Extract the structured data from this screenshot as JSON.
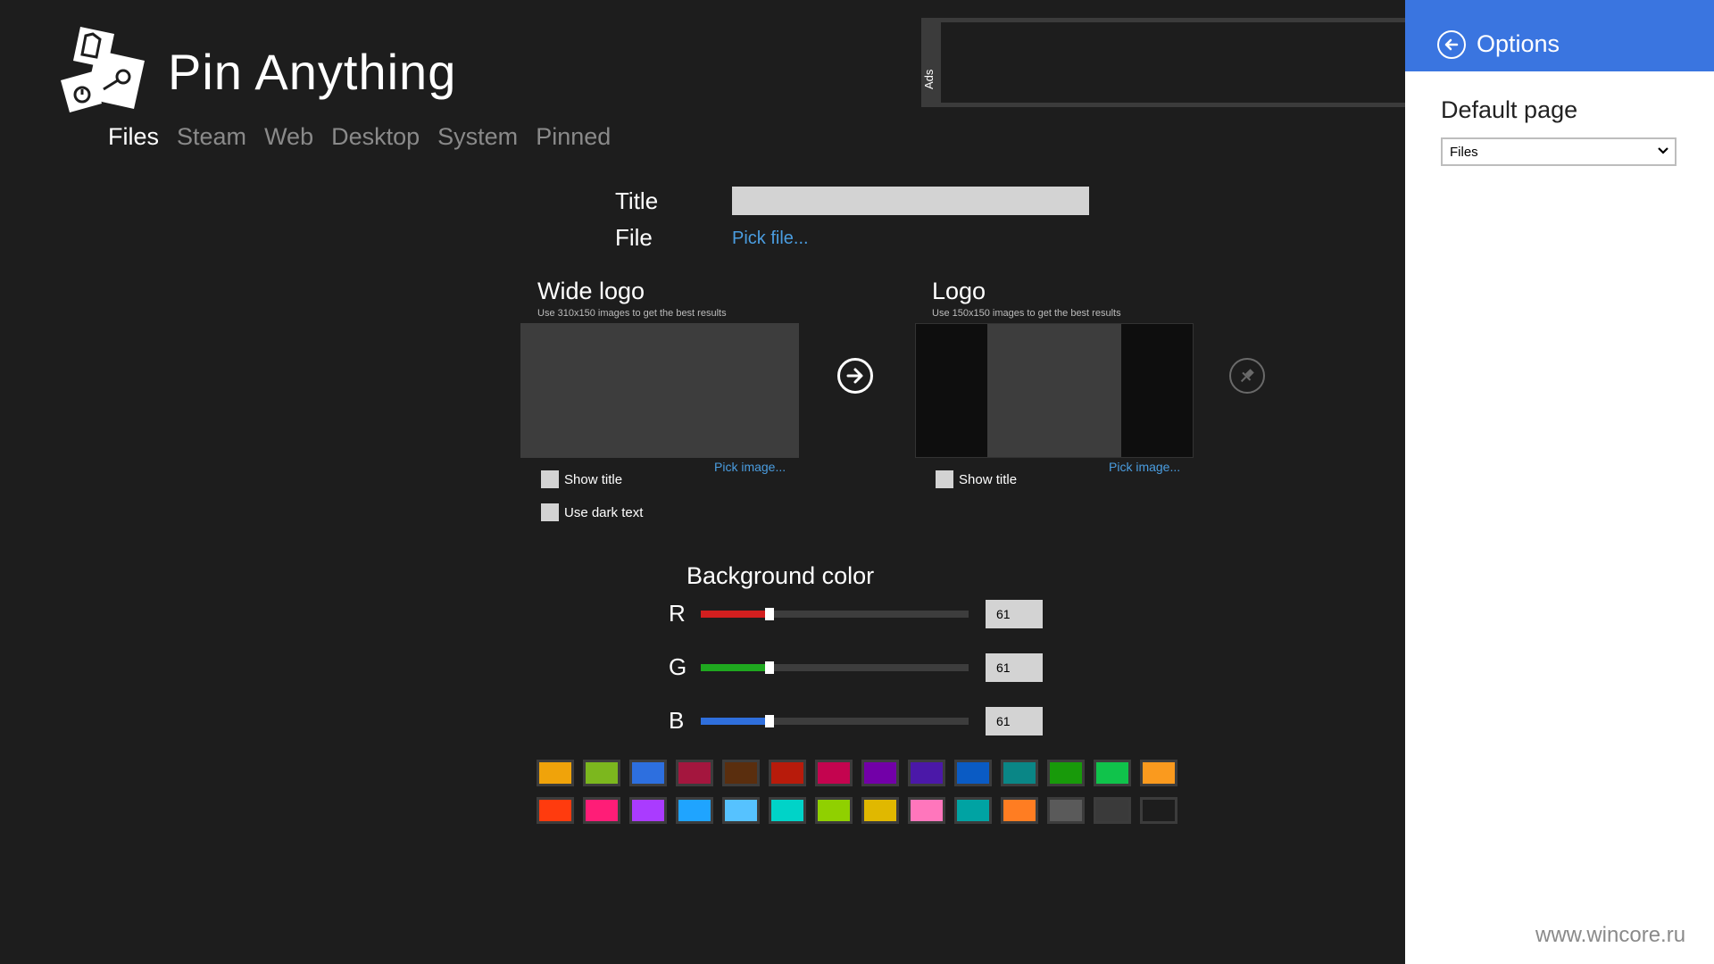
{
  "app": {
    "title": "Pin Anything"
  },
  "nav": {
    "tabs": [
      {
        "label": "Files",
        "active": true
      },
      {
        "label": "Steam"
      },
      {
        "label": "Web"
      },
      {
        "label": "Desktop"
      },
      {
        "label": "System"
      },
      {
        "label": "Pinned"
      }
    ]
  },
  "ads": {
    "label": "Ads"
  },
  "form": {
    "title_label": "Title",
    "title_value": "",
    "file_label": "File",
    "pick_file": "Pick file..."
  },
  "wide_logo": {
    "heading": "Wide logo",
    "hint": "Use 310x150 images to get the best results",
    "pick_image": "Pick image...",
    "show_title": "Show title",
    "use_dark_text": "Use dark text"
  },
  "logo": {
    "heading": "Logo",
    "hint": "Use 150x150 images to get the best results",
    "pick_image": "Pick image...",
    "show_title": "Show title"
  },
  "icons": {
    "go": "arrow-right-circle-icon",
    "pin": "pin-icon",
    "back": "arrow-left-circle-icon",
    "dropdown": "chevron-down-icon"
  },
  "background": {
    "heading": "Background color",
    "r": {
      "label": "R",
      "value": "61",
      "color": "#d21f1f"
    },
    "g": {
      "label": "G",
      "value": "61",
      "color": "#1fa81f"
    },
    "b": {
      "label": "B",
      "value": "61",
      "color": "#2f6fdc"
    },
    "level": 0.24
  },
  "swatches": {
    "row1": [
      "#f0a30a",
      "#7cb71e",
      "#2d6fdf",
      "#a4163e",
      "#5a2e0e",
      "#b81b0b",
      "#c4044f",
      "#7200a8",
      "#4b18a8",
      "#0a5bc4",
      "#0a8686",
      "#189a0a",
      "#10c34b",
      "#fa9a1e"
    ],
    "row2": [
      "#ff3b0e",
      "#ff1d77",
      "#aa3bff",
      "#1fa4ff",
      "#56c2ff",
      "#00d3c8",
      "#90d000",
      "#e0b800",
      "#ff76bc",
      "#00a3a3",
      "#ff7d22",
      "#5a5a5a",
      "#3a3a3a",
      "#1d1d1d"
    ]
  },
  "options": {
    "title": "Options",
    "default_page_label": "Default page",
    "default_page_value": "Files"
  },
  "watermark": "www.wincore.ru"
}
